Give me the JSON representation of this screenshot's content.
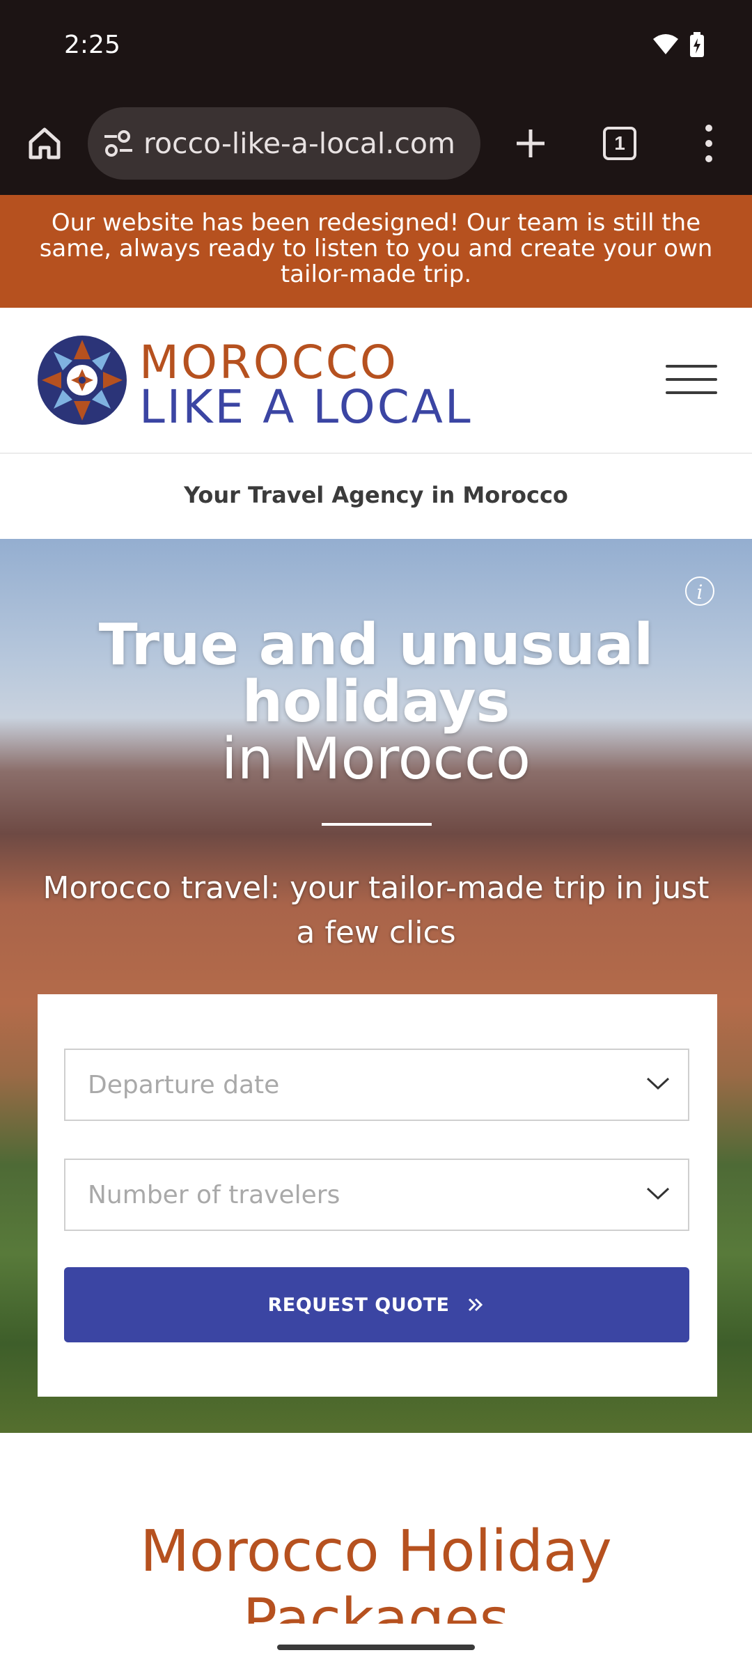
{
  "status_bar": {
    "time": "2:25"
  },
  "browser": {
    "url": "rocco-like-a-local.com",
    "tab_count": "1"
  },
  "announcement": "Our website has been redesigned! Our team is still the same, always ready to listen to you and create your own tailor-made trip.",
  "header": {
    "logo_line1": "MOROCCO",
    "logo_line2": "LIKE A LOCAL"
  },
  "tagline": "Your Travel Agency in Morocco",
  "hero": {
    "info_icon": "i",
    "title_line1": "True and unusual",
    "title_line2": "holidays",
    "title_line3": "in Morocco",
    "subtitle": "Morocco travel: your tailor-made trip in just a few clics"
  },
  "quote_form": {
    "departure_placeholder": "Departure date",
    "travelers_placeholder": "Number of travelers",
    "button_label": "REQUEST QUOTE"
  },
  "section": {
    "title": "Morocco Holiday Packages"
  },
  "colors": {
    "brand_orange": "#b6511f",
    "brand_blue": "#3b45a3",
    "dark_chrome": "#1c1414"
  }
}
